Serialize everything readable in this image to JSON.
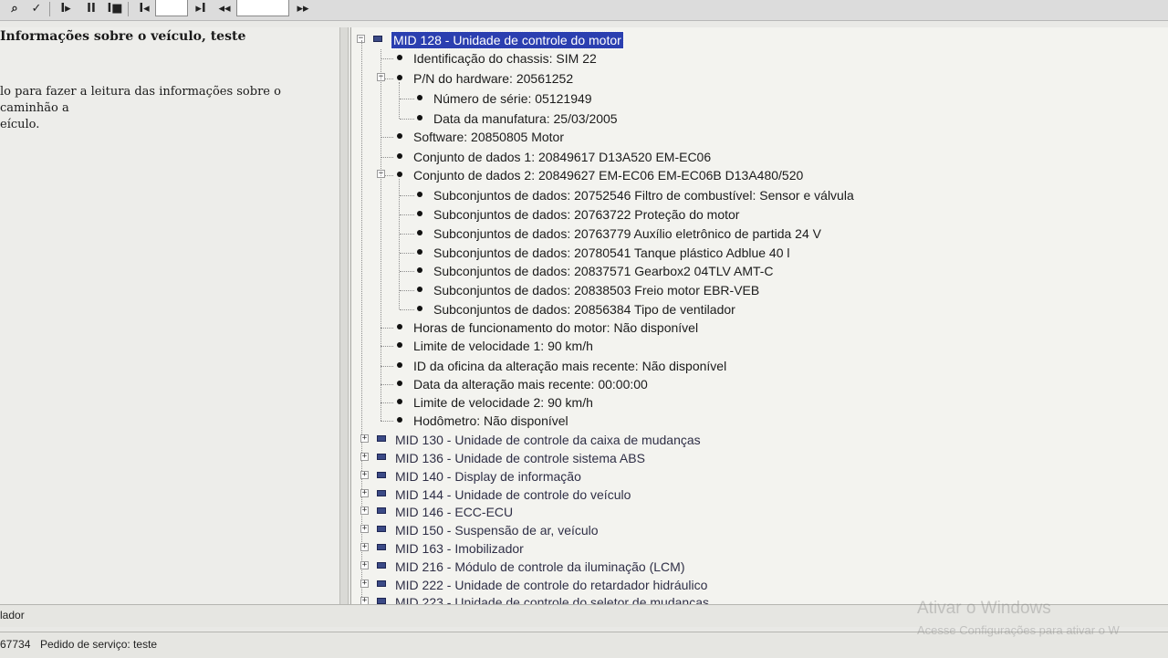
{
  "toolbar": {
    "buttons": [
      {
        "glyph": "⌕",
        "name": "search-icon"
      },
      {
        "glyph": "✓",
        "name": "check-icon"
      },
      {
        "glyph": "I▸",
        "name": "step-icon"
      },
      {
        "glyph": "II",
        "name": "pause-icon"
      },
      {
        "glyph": "I■",
        "name": "stop-icon"
      },
      {
        "glyph": "I◂",
        "name": "first-icon"
      },
      {
        "glyph": "▸I",
        "name": "last-icon"
      },
      {
        "glyph": "◂◂",
        "name": "rewind-icon"
      },
      {
        "glyph": "▸▸",
        "name": "forward-icon"
      }
    ],
    "input1_value": "",
    "input2_value": ""
  },
  "left_panel": {
    "title": "Informações sobre o veículo, teste",
    "description": "lo para fazer a leitura das informações sobre o caminhão a\neículo."
  },
  "tree": {
    "expanded_module": {
      "label": "MID 128 - Unidade de controle do motor",
      "children": [
        {
          "label": "Identificação do chassis:",
          "value": "SIM 22"
        },
        {
          "label": "P/N do hardware:",
          "value": "20561252",
          "expanded": true,
          "children": [
            {
              "label": "Número de série:",
              "value": "05121949"
            },
            {
              "label": "Data da manufatura:",
              "value": "25/03/2005"
            }
          ]
        },
        {
          "label": "Software:",
          "value": "20850805 Motor"
        },
        {
          "label": "Conjunto de dados 1:",
          "value": "20849617 D13A520 EM-EC06"
        },
        {
          "label": "Conjunto de dados 2:",
          "value": "20849627 EM-EC06 EM-EC06B D13A480/520",
          "expanded": true,
          "children": [
            {
              "label": "Subconjuntos de dados:",
              "value": "20752546 Filtro de combustível: Sensor e válvula"
            },
            {
              "label": "Subconjuntos de dados:",
              "value": "20763722 Proteção do motor"
            },
            {
              "label": "Subconjuntos de dados:",
              "value": "20763779 Auxílio eletrônico de partida 24 V"
            },
            {
              "label": "Subconjuntos de dados:",
              "value": "20780541 Tanque plástico Adblue 40 l"
            },
            {
              "label": "Subconjuntos de dados:",
              "value": "20837571 Gearbox2 04TLV AMT-C"
            },
            {
              "label": "Subconjuntos de dados:",
              "value": "20838503 Freio motor EBR-VEB"
            },
            {
              "label": "Subconjuntos de dados:",
              "value": "20856384 Tipo de ventilador"
            }
          ]
        },
        {
          "label": "Horas de funcionamento do motor:",
          "value": "Não disponível"
        },
        {
          "label": "Limite de velocidade 1:",
          "value": "90 km/h"
        },
        {
          "label": "ID da oficina da alteração mais recente:",
          "value": "Não disponível"
        },
        {
          "label": "Data da alteração mais recente:",
          "value": "00:00:00"
        },
        {
          "label": "Limite de velocidade 2:",
          "value": "90 km/h"
        },
        {
          "label": "Hodômetro:",
          "value": "Não disponível"
        }
      ]
    },
    "collapsed_modules": [
      "MID 130 - Unidade de controle da caixa de mudanças",
      "MID 136 - Unidade de controle sistema ABS",
      "MID 140 - Display de informação",
      "MID 144 - Unidade de controle do veículo",
      "MID 146 - ECC-ECU",
      "MID 150 - Suspensão de ar, veículo",
      "MID 163 - Imobilizador",
      "MID 216 - Módulo de controle da iluminação (LCM)",
      "MID 222 - Unidade de controle do retardador hidráulico",
      "MID 223 - Unidade de controle do seletor de mudanças"
    ]
  },
  "status": {
    "line1": "lador",
    "line2_left": "67734",
    "line2_right": "Pedido de serviço: teste"
  },
  "watermark": {
    "title": "Ativar o Windows",
    "subtitle": "Acesse Configurações para ativar o W"
  },
  "colors": {
    "selection": "#2b3fb0",
    "module_icon": "#3b4a86"
  }
}
